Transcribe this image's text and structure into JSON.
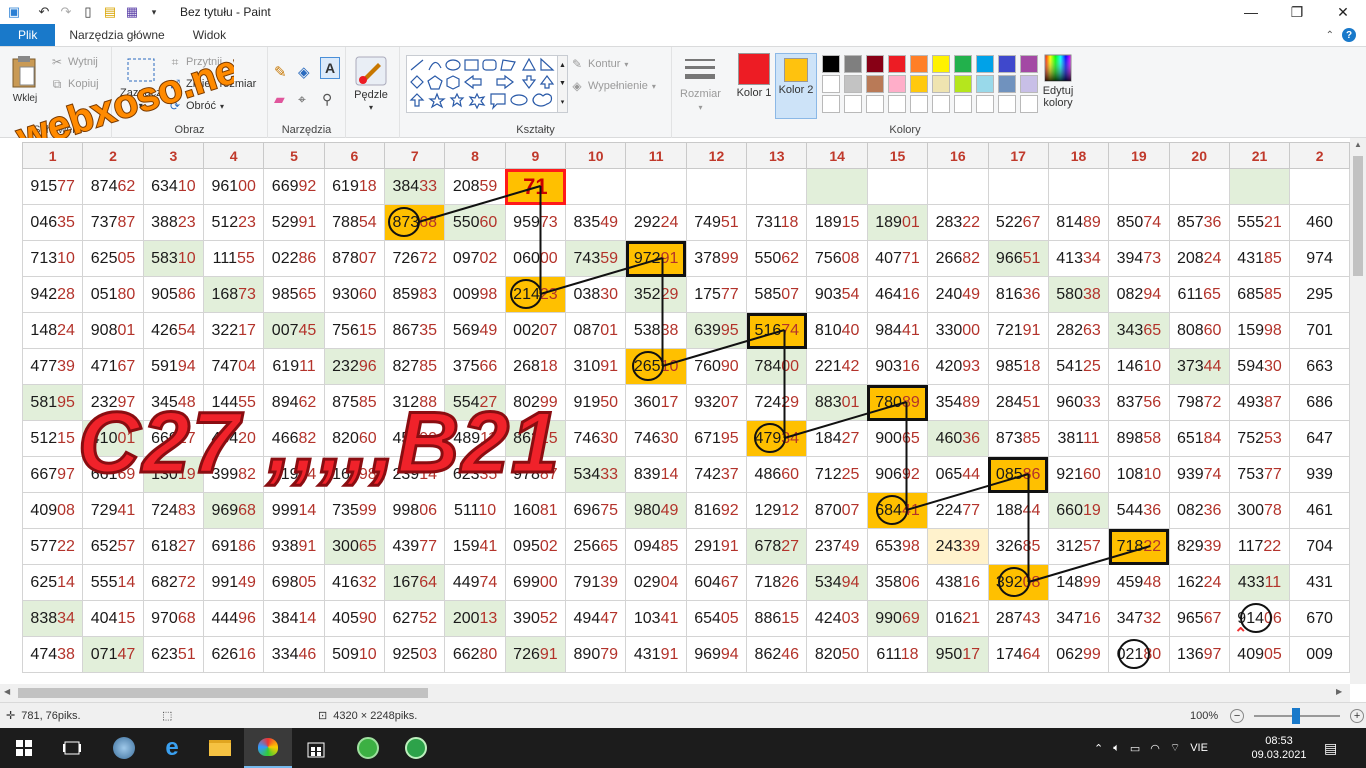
{
  "window": {
    "title": "Bez tytułu - Paint",
    "minimize": "—",
    "maximize": "❐",
    "close": "✕"
  },
  "menu": {
    "file": "Plik",
    "tabs": [
      "Narzędzia główne",
      "Widok"
    ],
    "help": "?"
  },
  "watermark": "webxoso.net",
  "ribbon": {
    "clipboard": {
      "label": "Schowek",
      "paste": "Wklej",
      "cut": "Wytnij",
      "copy": "Kopiuj"
    },
    "image": {
      "label": "Obraz",
      "select": "Zaznacz",
      "crop": "Przytnij",
      "resize": "Zmień rozmiar",
      "rotate": "Obróć"
    },
    "tools": {
      "label": "Narzędzia"
    },
    "brushes": {
      "label": "Pędzle"
    },
    "shapes": {
      "label": "Kształty",
      "outline": "Kontur",
      "fill": "Wypełnienie"
    },
    "size": {
      "label": "Rozmiar"
    },
    "colors": {
      "label": "Kolory",
      "color1": "Kolor 1",
      "color2": "Kolor 2",
      "edit": "Edytuj kolory",
      "color1_hex": "#ed1c24",
      "color2_hex": "#ffc20e",
      "palette_row1": [
        "#000000",
        "#7f7f7f",
        "#880015",
        "#ed1c24",
        "#ff7f27",
        "#fff200",
        "#22b14c",
        "#00a2e8",
        "#3f48cc",
        "#a349a4"
      ],
      "palette_row2": [
        "#ffffff",
        "#c3c3c3",
        "#b97a57",
        "#ffaec9",
        "#ffc90e",
        "#efe4b0",
        "#b5e61d",
        "#99d9ea",
        "#7092be",
        "#c8bfe7"
      ]
    }
  },
  "sheet": {
    "columns": [
      "1",
      "2",
      "3",
      "4",
      "5",
      "6",
      "7",
      "8",
      "9",
      "10",
      "11",
      "12",
      "13",
      "14",
      "15",
      "16",
      "17",
      "18",
      "19",
      "20",
      "21",
      "2"
    ],
    "rows": [
      [
        "91577",
        "87462",
        "63410",
        "96100",
        "66992",
        "61918",
        "38433",
        "20859",
        "71",
        "",
        "",
        "",
        "",
        "",
        "",
        "",
        "",
        "",
        "",
        "",
        "",
        ""
      ],
      [
        "04635",
        "73787",
        "38823",
        "51223",
        "52991",
        "78854",
        "87368",
        "55060",
        "95973",
        "83549",
        "29224",
        "74951",
        "73118",
        "18915",
        "18901",
        "28322",
        "52267",
        "81489",
        "85074",
        "85736",
        "55521",
        "460"
      ],
      [
        "71310",
        "62505",
        "58310",
        "11155",
        "02286",
        "87807",
        "72672",
        "09702",
        "06000",
        "74359",
        "97291",
        "37899",
        "55062",
        "75608",
        "40771",
        "26682",
        "96651",
        "41334",
        "39473",
        "20824",
        "43185",
        "974"
      ],
      [
        "94228",
        "05180",
        "90586",
        "16873",
        "98565",
        "93060",
        "85983",
        "00998",
        "21423",
        "03830",
        "35229",
        "17577",
        "58507",
        "90354",
        "46416",
        "24049",
        "81636",
        "58038",
        "08294",
        "61165",
        "68585",
        "295"
      ],
      [
        "14824",
        "90801",
        "42654",
        "32217",
        "00745",
        "75615",
        "86735",
        "56949",
        "00207",
        "08701",
        "53838",
        "63995",
        "51674",
        "81040",
        "98441",
        "33000",
        "72191",
        "28263",
        "34365",
        "80860",
        "15998",
        "701"
      ],
      [
        "47739",
        "47167",
        "59194",
        "74704",
        "61911",
        "23296",
        "82785",
        "37566",
        "26818",
        "31091",
        "26510",
        "76090",
        "78400",
        "22142",
        "90316",
        "42093",
        "98518",
        "54125",
        "14610",
        "37344",
        "59430",
        "663"
      ],
      [
        "58195",
        "23297",
        "34548",
        "14455",
        "89462",
        "87585",
        "31288",
        "55427",
        "80299",
        "91950",
        "36017",
        "93207",
        "72429",
        "88301",
        "78089",
        "35489",
        "28451",
        "96033",
        "83756",
        "79872",
        "49387",
        "686"
      ],
      [
        "51215",
        "41001",
        "66927",
        "45420",
        "46682",
        "82060",
        "45290",
        "48911",
        "86215",
        "74630",
        "74630",
        "67195",
        "47934",
        "18427",
        "90065",
        "46036",
        "87385",
        "38111",
        "89858",
        "65184",
        "75253",
        "647"
      ],
      [
        "66797",
        "66169",
        "13019",
        "39982",
        "91904",
        "16798",
        "23914",
        "62335",
        "97887",
        "53433",
        "83914",
        "74237",
        "48660",
        "71225",
        "90692",
        "06544",
        "08586",
        "92160",
        "10810",
        "93974",
        "75377",
        "939"
      ],
      [
        "40908",
        "72941",
        "72483",
        "96968",
        "99914",
        "73599",
        "99806",
        "51110",
        "16081",
        "69675",
        "98049",
        "81692",
        "12912",
        "87007",
        "68441",
        "22477",
        "18844",
        "66019",
        "54436",
        "08236",
        "30078",
        "461"
      ],
      [
        "57722",
        "65257",
        "61827",
        "69186",
        "93891",
        "30065",
        "43977",
        "15941",
        "09502",
        "25665",
        "09485",
        "29191",
        "67827",
        "23749",
        "65398",
        "24339",
        "32685",
        "31257",
        "71822",
        "82939",
        "11722",
        "704"
      ],
      [
        "62514",
        "55514",
        "68272",
        "99149",
        "69805",
        "41632",
        "16764",
        "44974",
        "69900",
        "79139",
        "02904",
        "60467",
        "71826",
        "53494",
        "35806",
        "43816",
        "39208",
        "14899",
        "45948",
        "16224",
        "43311",
        "431"
      ],
      [
        "83834",
        "40415",
        "97068",
        "44496",
        "38414",
        "40590",
        "62752",
        "20013",
        "39052",
        "49447",
        "10341",
        "65405",
        "88615",
        "42403",
        "99069",
        "01621",
        "28743",
        "34716",
        "34732",
        "96567",
        "91406",
        "670"
      ],
      [
        "47438",
        "07147",
        "62351",
        "62616",
        "33446",
        "50910",
        "92503",
        "66280",
        "72691",
        "89079",
        "43191",
        "96994",
        "86246",
        "82050",
        "61118",
        "95017",
        "17464",
        "06299",
        "02180",
        "13697",
        "40905",
        "009"
      ]
    ]
  },
  "overlay_text": "C27 ,,,,,B21",
  "status": {
    "cursor": "781, 76piks.",
    "size": "4320 × 2248piks.",
    "zoom": "100%"
  },
  "taskbar": {
    "lang": "VIE",
    "time": "08:53",
    "date": "09.03.2021"
  }
}
